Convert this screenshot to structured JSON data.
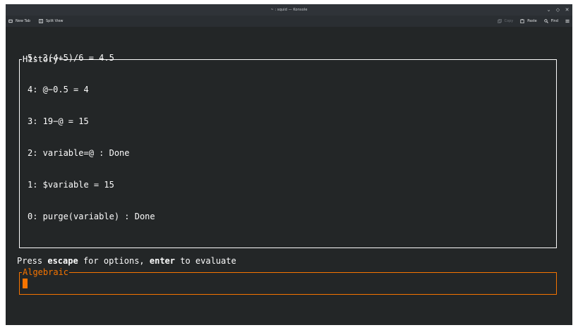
{
  "window": {
    "title": "~ : squid — Konsole",
    "controls": {
      "minimize": "⌄",
      "maximize": "◇",
      "close": "✕"
    }
  },
  "toolbar": {
    "new_tab_label": "New Tab",
    "split_view_label": "Split View",
    "copy_label": "Copy",
    "paste_label": "Paste",
    "find_label": "Find"
  },
  "terminal": {
    "history": {
      "label": "History",
      "lines": [
        "5: 3(4+5)/6 = 4.5",
        "4: @−0.5 = 4",
        "3: 19−@ = 15",
        "2: variable=@ : Done",
        "1: $variable = 15",
        "0: purge(variable) : Done"
      ]
    },
    "hint": {
      "prefix": "Press ",
      "key1": "escape",
      "middle": " for options, ",
      "key2": "enter",
      "suffix": " to evaluate"
    },
    "input": {
      "label": "Algebraic",
      "value": ""
    }
  },
  "colors": {
    "accent": "#f67400",
    "terminal_bg": "#232627",
    "terminal_fg": "#fcfcfc"
  },
  "icons": {
    "new_tab": "new-tab-icon",
    "split_view": "split-view-icon",
    "copy": "copy-icon",
    "paste": "paste-icon",
    "find": "search-icon",
    "menu": "hamburger-menu-icon"
  }
}
